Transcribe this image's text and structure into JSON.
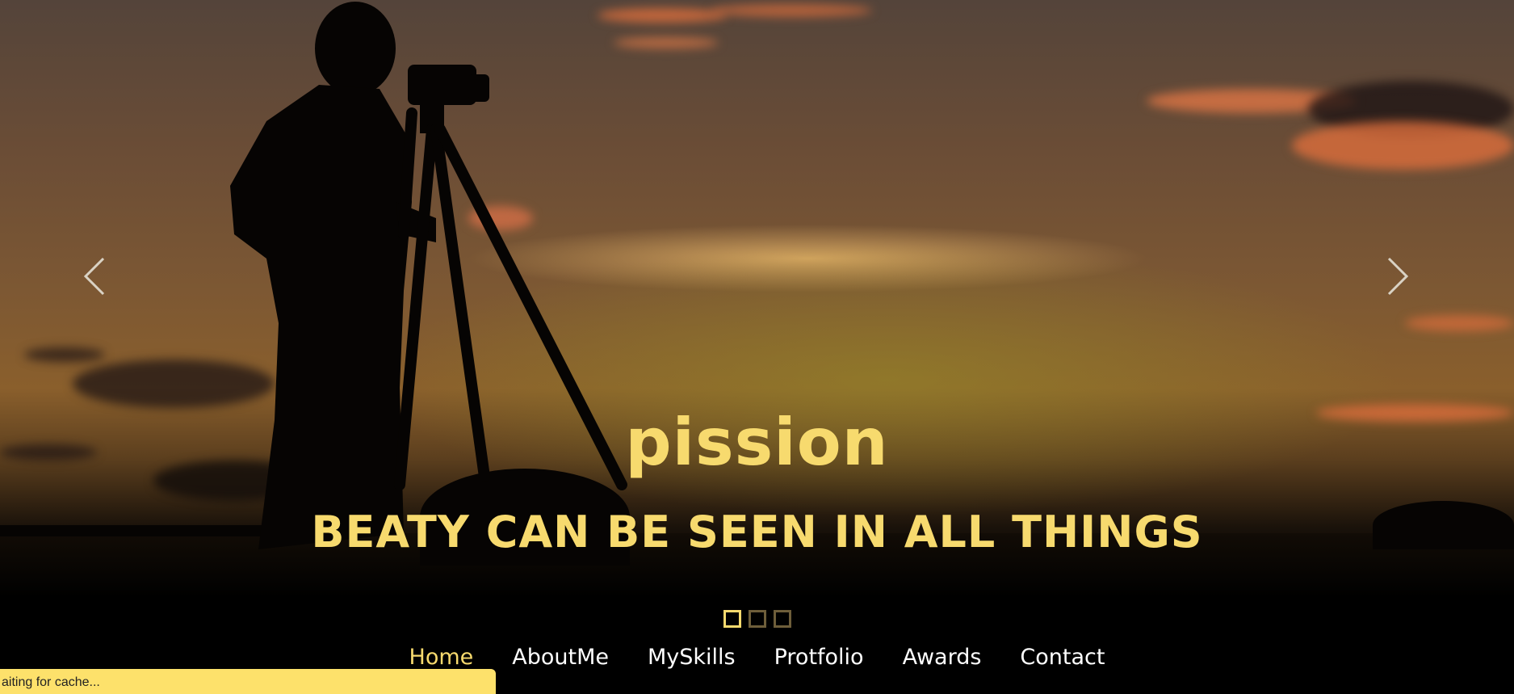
{
  "hero": {
    "title": "pission",
    "subtitle": "BEATY CAN BE SEEN IN ALL THINGS",
    "prev_icon": "chevron-left-icon",
    "next_icon": "chevron-right-icon",
    "slide_count": 3,
    "active_slide": 1
  },
  "nav": {
    "items": [
      "Home",
      "AboutMe",
      "MySkills",
      "Protfolio",
      "Awards",
      "Contact"
    ],
    "active": "Home"
  },
  "status_bar": {
    "text": "aiting for cache..."
  },
  "colors": {
    "accent": "#f7da6e",
    "nav_text": "#ffffff",
    "status_bg": "#fde16b"
  }
}
